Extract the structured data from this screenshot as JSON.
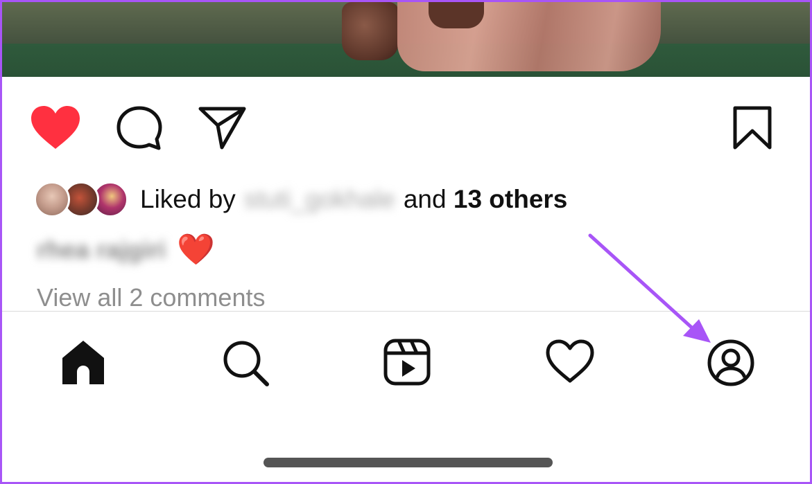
{
  "post": {
    "actions": {
      "like": "heart-filled-icon",
      "comment": "comment-icon",
      "share": "send-icon",
      "save": "bookmark-icon"
    },
    "liked_by_prefix": "Liked by",
    "liked_by_user": "stuti_gokhale",
    "liked_by_and": "and",
    "liked_by_others": "13 others",
    "caption_user": "rhea rajgiri",
    "caption_emoji": "❤️",
    "view_comments": "View all 2 comments"
  },
  "nav": {
    "items": [
      {
        "icon": "home-icon"
      },
      {
        "icon": "search-icon"
      },
      {
        "icon": "reels-icon"
      },
      {
        "icon": "heart-icon"
      },
      {
        "icon": "profile-icon"
      }
    ]
  },
  "colors": {
    "like_red": "#ff3040",
    "annotation_purple": "#a855f7",
    "secondary_text": "#8e8e8e"
  }
}
